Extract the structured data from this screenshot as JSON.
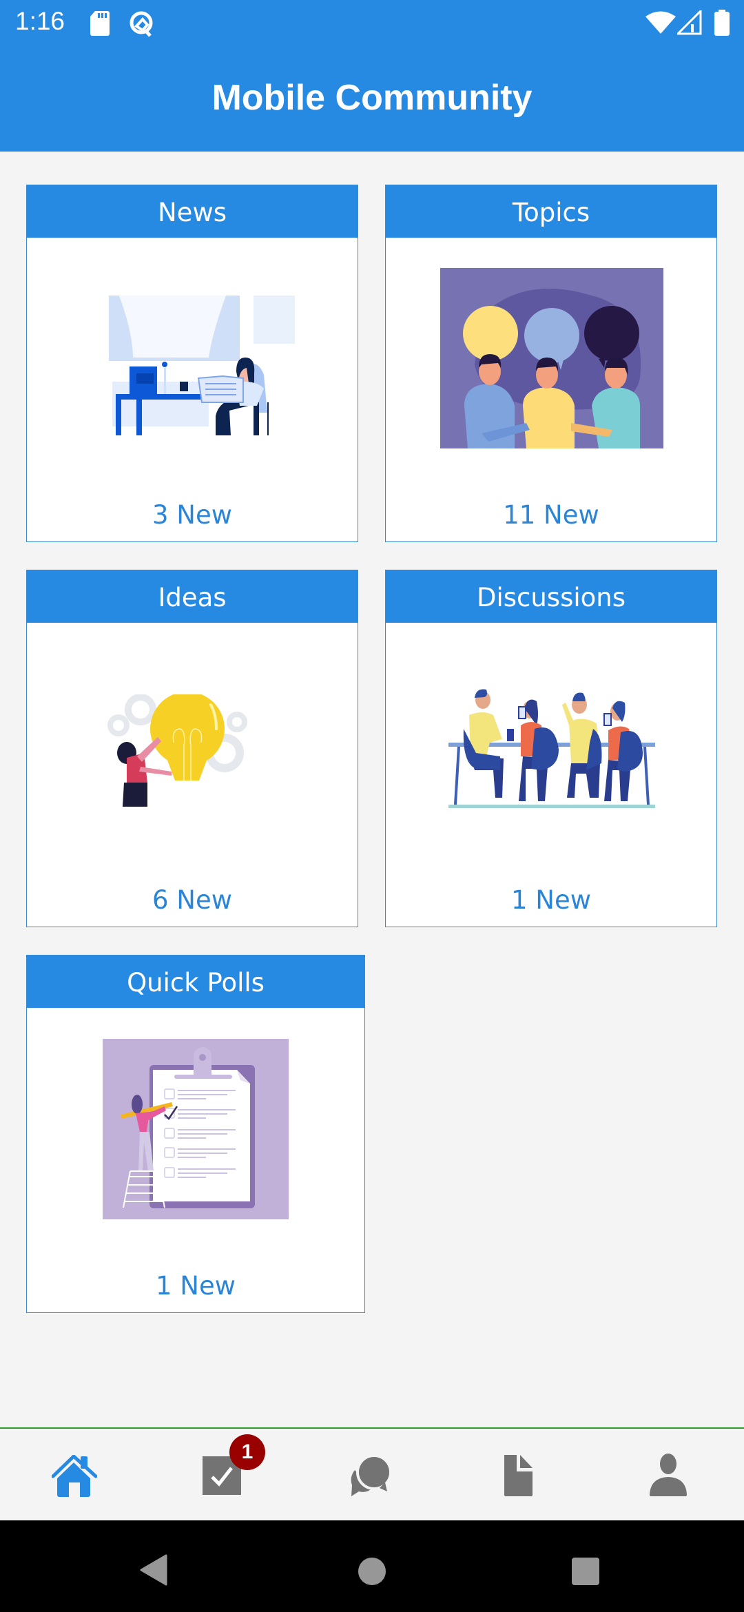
{
  "status_bar": {
    "time": "1:16",
    "left_icons": [
      "sd-card-icon",
      "q-logo-icon"
    ],
    "right_icons": [
      "wifi-icon",
      "cell-signal-icon",
      "battery-icon"
    ]
  },
  "app_bar": {
    "title": "Mobile Community"
  },
  "colors": {
    "primary": "#2689e2",
    "count_text": "#2b85d6",
    "badge": "#990000",
    "nav_inactive": "#737373",
    "nav_border": "#2e9a2e"
  },
  "cards": [
    {
      "title": "News",
      "count_label": "3 New",
      "image": "person-reading-newspaper-illustration"
    },
    {
      "title": "Topics",
      "count_label": "11 New",
      "image": "people-speech-bubbles-illustration"
    },
    {
      "title": "Ideas",
      "count_label": "6 New",
      "image": "woman-lightbulb-gears-illustration"
    },
    {
      "title": "Discussions",
      "count_label": "1 New",
      "image": "people-at-table-illustration"
    },
    {
      "title": "Quick Polls",
      "count_label": "1 New",
      "image": "clipboard-checklist-illustration"
    }
  ],
  "bottom_nav": {
    "items": [
      {
        "name": "home",
        "icon": "home-icon",
        "active": true
      },
      {
        "name": "tasks",
        "icon": "checkbox-icon",
        "active": false,
        "badge": "1"
      },
      {
        "name": "chat",
        "icon": "chat-bubbles-icon",
        "active": false
      },
      {
        "name": "documents",
        "icon": "document-icon",
        "active": false
      },
      {
        "name": "profile",
        "icon": "person-icon",
        "active": false
      }
    ]
  },
  "system_nav": {
    "buttons": [
      "back",
      "home",
      "recents"
    ]
  }
}
